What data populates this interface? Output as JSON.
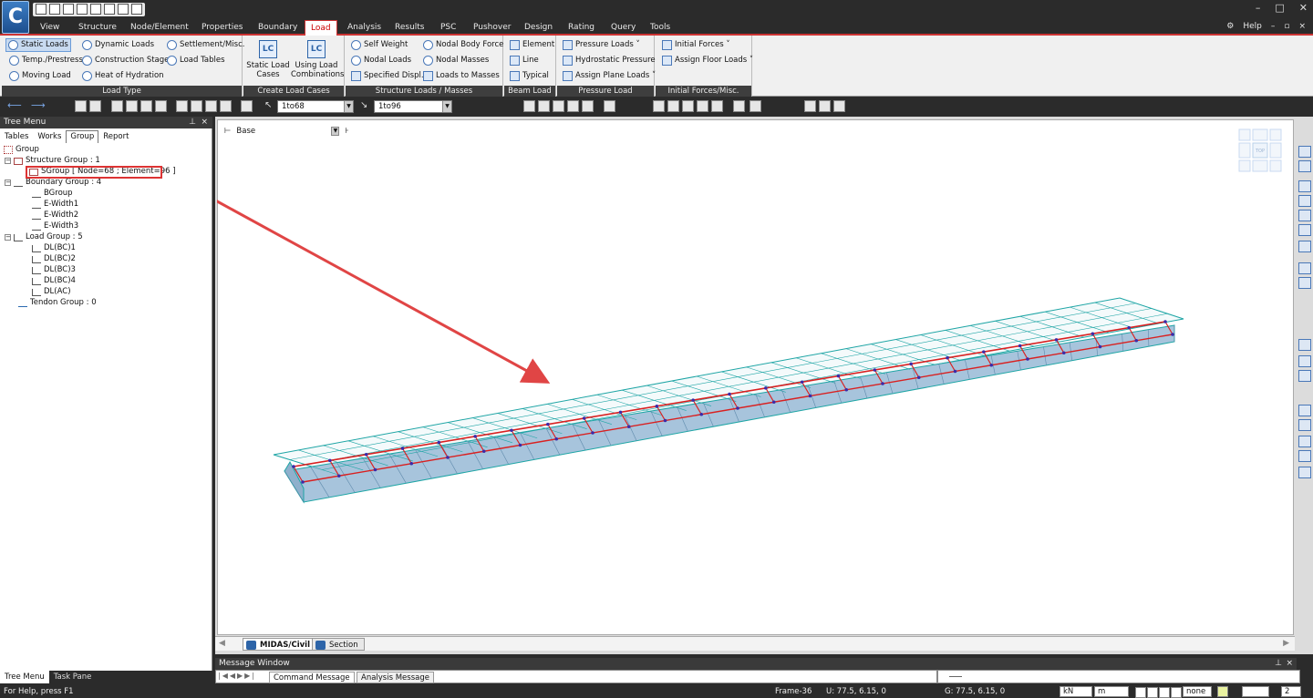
{
  "app": {
    "logo_letter": "C"
  },
  "window_controls": {
    "minimize": "–",
    "maximize": "□",
    "close": "✕"
  },
  "menu": {
    "items": [
      "View",
      "Structure",
      "Node/Element",
      "Properties",
      "Boundary",
      "Load",
      "Analysis",
      "Results",
      "PSC",
      "Pushover",
      "Design",
      "Rating",
      "Query",
      "Tools"
    ],
    "active": "Load",
    "help_label": "Help"
  },
  "ribbon": {
    "load_type": {
      "label": "Load Type",
      "items": [
        "Static Loads",
        "Dynamic Loads",
        "Settlement/Misc.",
        "Temp./Prestress",
        "Construction Stage",
        "Load Tables",
        "Moving Load",
        "Heat of Hydration"
      ],
      "selected": "Static Loads"
    },
    "create_load_cases": {
      "label": "Create Load Cases",
      "static_label": "Static Load Cases",
      "static_icon": "LC",
      "comb_label": "Using Load Combinations",
      "comb_icon": "LC"
    },
    "structure_loads": {
      "label": "Structure Loads / Masses",
      "items": [
        "Self Weight",
        "Nodal Body Force",
        "Nodal Loads",
        "Nodal Masses",
        "Specified Displ.",
        "Loads to Masses"
      ]
    },
    "beam_load": {
      "label": "Beam Load",
      "items": [
        "Element",
        "Line",
        "Typical"
      ]
    },
    "pressure_load": {
      "label": "Pressure Load",
      "items": [
        "Pressure Loads ˅",
        "Hydrostatic Pressure",
        "Assign Plane Loads ˅"
      ]
    },
    "initial_forces": {
      "label": "Initial Forces/Misc.",
      "items": [
        "Initial Forces ˅",
        "Assign Floor Loads ˅"
      ]
    }
  },
  "toolbar": {
    "node_select": "1to68",
    "element_select": "1to96"
  },
  "tree": {
    "title": "Tree Menu",
    "tabs": [
      "Tables",
      "Works",
      "Group",
      "Report"
    ],
    "active_tab": "Group",
    "nodes": [
      {
        "label": "Group"
      },
      {
        "label": "Structure Group : 1"
      },
      {
        "label": "SGroup [ Node=68 ; Element=96 ]"
      },
      {
        "label": "Boundary Group : 4"
      },
      {
        "label": "BGroup"
      },
      {
        "label": "E-Width1"
      },
      {
        "label": "E-Width2"
      },
      {
        "label": "E-Width3"
      },
      {
        "label": "Load Group : 5"
      },
      {
        "label": "DL(BC)1"
      },
      {
        "label": "DL(BC)2"
      },
      {
        "label": "DL(BC)3"
      },
      {
        "label": "DL(BC)4"
      },
      {
        "label": "DL(AC)"
      },
      {
        "label": "Tendon Group : 0"
      }
    ],
    "footer_tabs": [
      "Tree Menu",
      "Task Pane"
    ]
  },
  "viewport": {
    "story": "Base",
    "view_cube_label": "TOP",
    "tabs": [
      "MIDAS/Civil",
      "Section"
    ],
    "active_tab": "MIDAS/Civil",
    "colors": {
      "box": "#a7c4dc",
      "mesh": "#1ea5a5",
      "tendon": "#d92020",
      "arrow": "#e04545",
      "node": "#3c2aa8"
    }
  },
  "message_window": {
    "title": "Message Window",
    "tabs": [
      "Command Message",
      "Analysis Message"
    ],
    "active_tab": "Command Message"
  },
  "status": {
    "help": "For Help, press F1",
    "frame": "Frame-36",
    "u": "U: 77.5, 6.15, 0",
    "g": "G: 77.5, 6.15, 0",
    "force_unit": "kN",
    "length_unit": "m",
    "none": "none",
    "page": "2"
  }
}
